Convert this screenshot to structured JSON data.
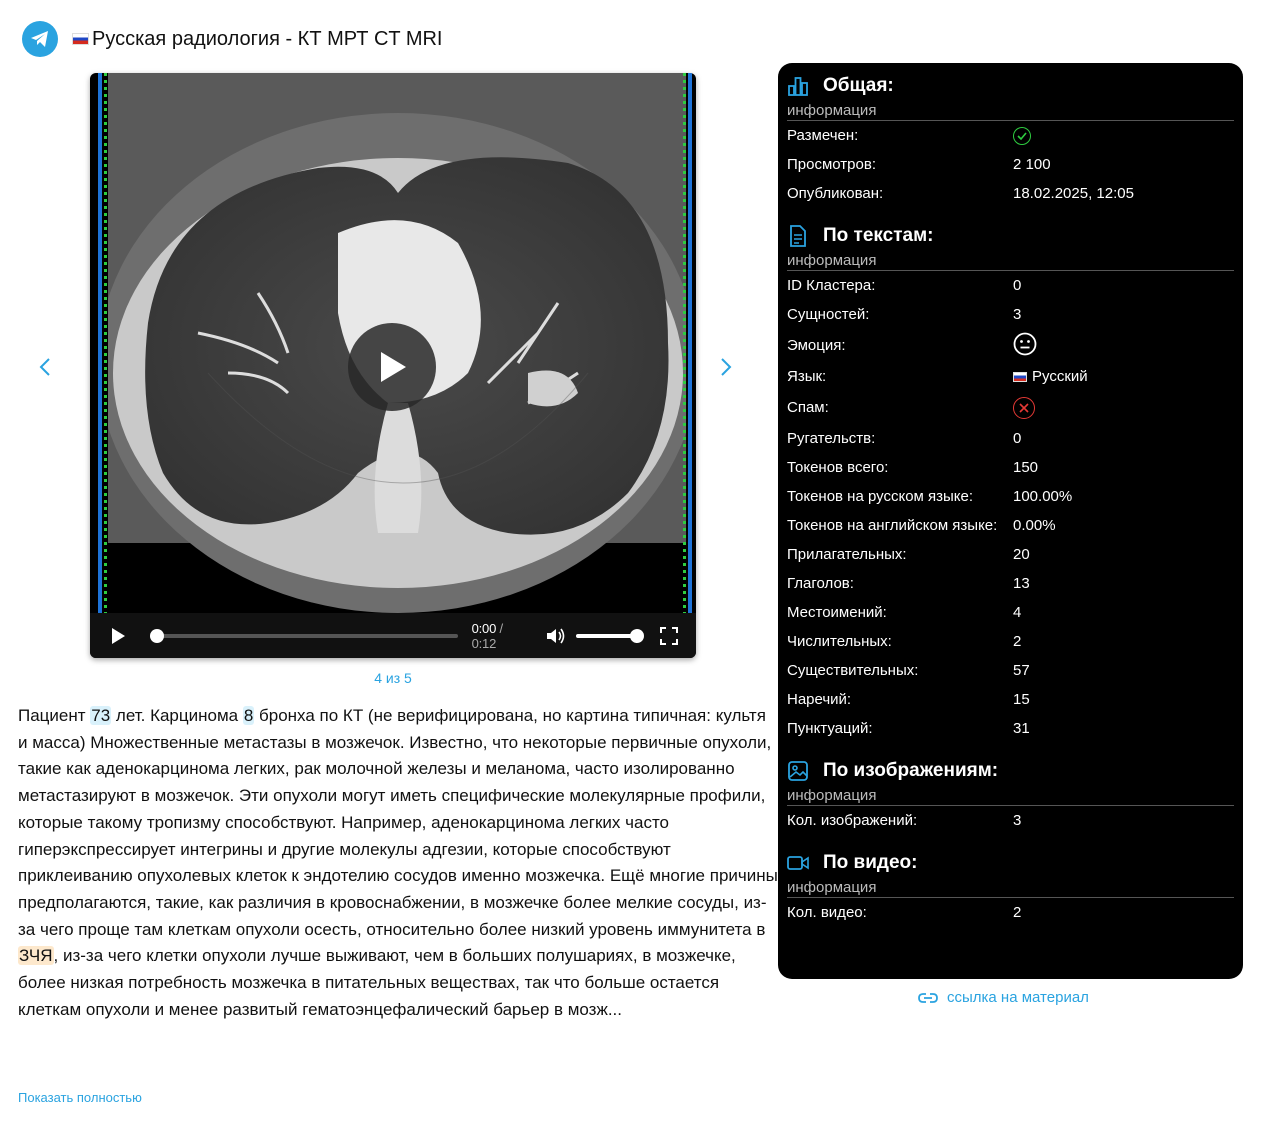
{
  "header": {
    "title": "Русская радиология - КТ МРТ CT MRI"
  },
  "player": {
    "time_current": "0:00",
    "time_separator": " / ",
    "time_duration": "0:12",
    "progress": 0.0,
    "volume": 1.0
  },
  "carousel": {
    "counter": "4 из 5"
  },
  "post": {
    "p1": "Пациент ",
    "n1": "73",
    "p2": " лет. Карцинома ",
    "n2": "8",
    "p3": " бронха по КТ (не верифицирована, но картина типичная: культя и масса) Множественные метастазы в мозжечок. Известно, что некоторые первичные опухоли, такие как аденокарцинома легких, рак молочной железы и меланома, часто изолированно метастазируют в мозжечок. Эти опухоли могут иметь специфические молекулярные профили, которые такому тропизму способствуют. Например, аденокарцинома легких часто гиперэкспрессирует интегрины и другие молекулы адгезии, которые способствуют приклеиванию опухолевых клеток к эндотелию сосудов именно мозжечка. Ещё многие причины предполагаются, такие, как различия в кровоснабжении, в мозжечке более мелкие сосуды, из-за чего проще там клеткам опухоли осесть, относительно более низкий уровень иммунитета в ",
    "abbr": "ЗЧЯ",
    "p4": ", из-за чего клетки опухоли лучше выживают, чем в больших полушариях, в мозжечке, более низкая потребность мозжечка в питательных веществах, так что больше остается клеткам опухоли и менее развитый гематоэнцефалический барьер в мозж...",
    "show_more": "Показать полностью"
  },
  "panel": {
    "general": {
      "title": "Общая:",
      "subtitle": "информация",
      "rows": [
        {
          "key": "Размечен:",
          "value": ""
        },
        {
          "key": "Просмотров:",
          "value": "2 100"
        },
        {
          "key": "Опубликован:",
          "value": "18.02.2025, 12:05"
        }
      ]
    },
    "texts": {
      "title": "По текстам:",
      "subtitle": "информация",
      "rows": [
        {
          "key": "ID Кластера:",
          "value": "0"
        },
        {
          "key": "Сущностей:",
          "value": "3"
        },
        {
          "key": "Эмоция:",
          "value": ""
        },
        {
          "key": "Язык:",
          "value": "Русский"
        },
        {
          "key": "Спам:",
          "value": ""
        },
        {
          "key": "Ругательств:",
          "value": "0"
        },
        {
          "key": "Токенов всего:",
          "value": "150"
        },
        {
          "key": "Токенов на русском языке:",
          "value": "100.00%"
        },
        {
          "key": "Токенов на английском языке:",
          "value": "0.00%"
        },
        {
          "key": "Прилагательных:",
          "value": "20"
        },
        {
          "key": "Глаголов:",
          "value": "13"
        },
        {
          "key": "Местоимений:",
          "value": "4"
        },
        {
          "key": "Числительных:",
          "value": "2"
        },
        {
          "key": "Существительных:",
          "value": "57"
        },
        {
          "key": "Наречий:",
          "value": "15"
        },
        {
          "key": "Пунктуаций:",
          "value": "31"
        }
      ]
    },
    "images": {
      "title": "По изображениям:",
      "subtitle": "информация",
      "rows": [
        {
          "key": "Кол. изображений:",
          "value": "3"
        }
      ]
    },
    "video": {
      "title": "По видео:",
      "subtitle": "информация",
      "rows": [
        {
          "key": "Кол. видео:",
          "value": "2"
        }
      ]
    }
  },
  "link": {
    "label": "ссылка на материал"
  },
  "colors": {
    "accent": "#2aa3e0",
    "ok": "#2ecc40",
    "error": "#e53935",
    "panel_bg": "#000000"
  },
  "icons": [
    "telegram-icon",
    "chevron-left-icon",
    "chevron-right-icon",
    "play-icon",
    "volume-icon",
    "fullscreen-icon",
    "chart-icon",
    "document-icon",
    "image-icon",
    "video-camera-icon",
    "check-circle-icon",
    "neutral-face-icon",
    "cross-circle-icon",
    "link-icon"
  ]
}
